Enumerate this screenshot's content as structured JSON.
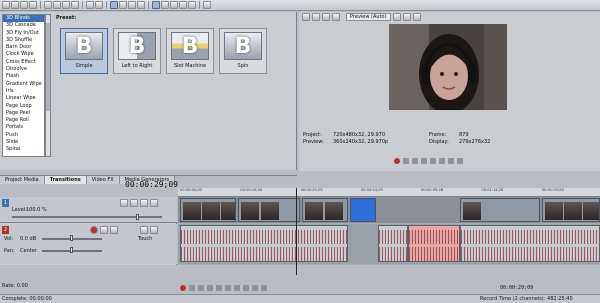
{
  "transitions": {
    "items": [
      "3D Blinds",
      "3D Cascade",
      "3D Fly In/Out",
      "3D Shuffle",
      "Barn Door",
      "Clock Wipe",
      "Cross Effect",
      "Dissolve",
      "Flash",
      "Gradient Wipe",
      "Iris",
      "Linear Wipe",
      "Page Loop",
      "Page Peel",
      "Page Roll",
      "Portals",
      "Push",
      "Slide",
      "Spiral"
    ],
    "selected_index": 0,
    "preset_label": "Preset:",
    "presets": [
      {
        "label": "Simple",
        "glyph": "B"
      },
      {
        "label": "Left to Right",
        "glyph": "B"
      },
      {
        "label": "Slot Machine",
        "glyph": "B"
      },
      {
        "label": "Spin",
        "glyph": "B"
      }
    ]
  },
  "tabs": [
    "Project Media",
    "Transitions",
    "Video FX",
    "Media Generators"
  ],
  "active_tab": "Transitions",
  "preview": {
    "mode": "Preview (Auto)",
    "project_label": "Project:",
    "project_value": "720x480x32, 29.970",
    "preview_label": "Preview:",
    "preview_value": "360x240x32, 29.970p",
    "frame_label": "Frame:",
    "frame_value": "879",
    "display_label": "Display:",
    "display_value": "279x276x32"
  },
  "timeline": {
    "timecode": "00:00:29;09",
    "ruler": [
      "00:00:00;00",
      "00:00:15;00",
      "00:00:29;29",
      "00:00:44;29",
      "00:00:59;28",
      "00:01:14;28",
      "00:01:29;29"
    ],
    "video_track": {
      "number": "1",
      "level_label": "Level:",
      "level_value": "100.0 %"
    },
    "audio_track": {
      "number": "2",
      "vol_label": "Vol:",
      "vol_value": "0.0 dB",
      "pan_label": "Pan:",
      "pan_value": "Center",
      "touch": "Touch"
    },
    "rate": "Rate: 0.00",
    "end_time": "00:00:29;09",
    "complete": "Complete: 00:00:00",
    "record_time": "Record Time (2 channels): 482:25:40"
  }
}
